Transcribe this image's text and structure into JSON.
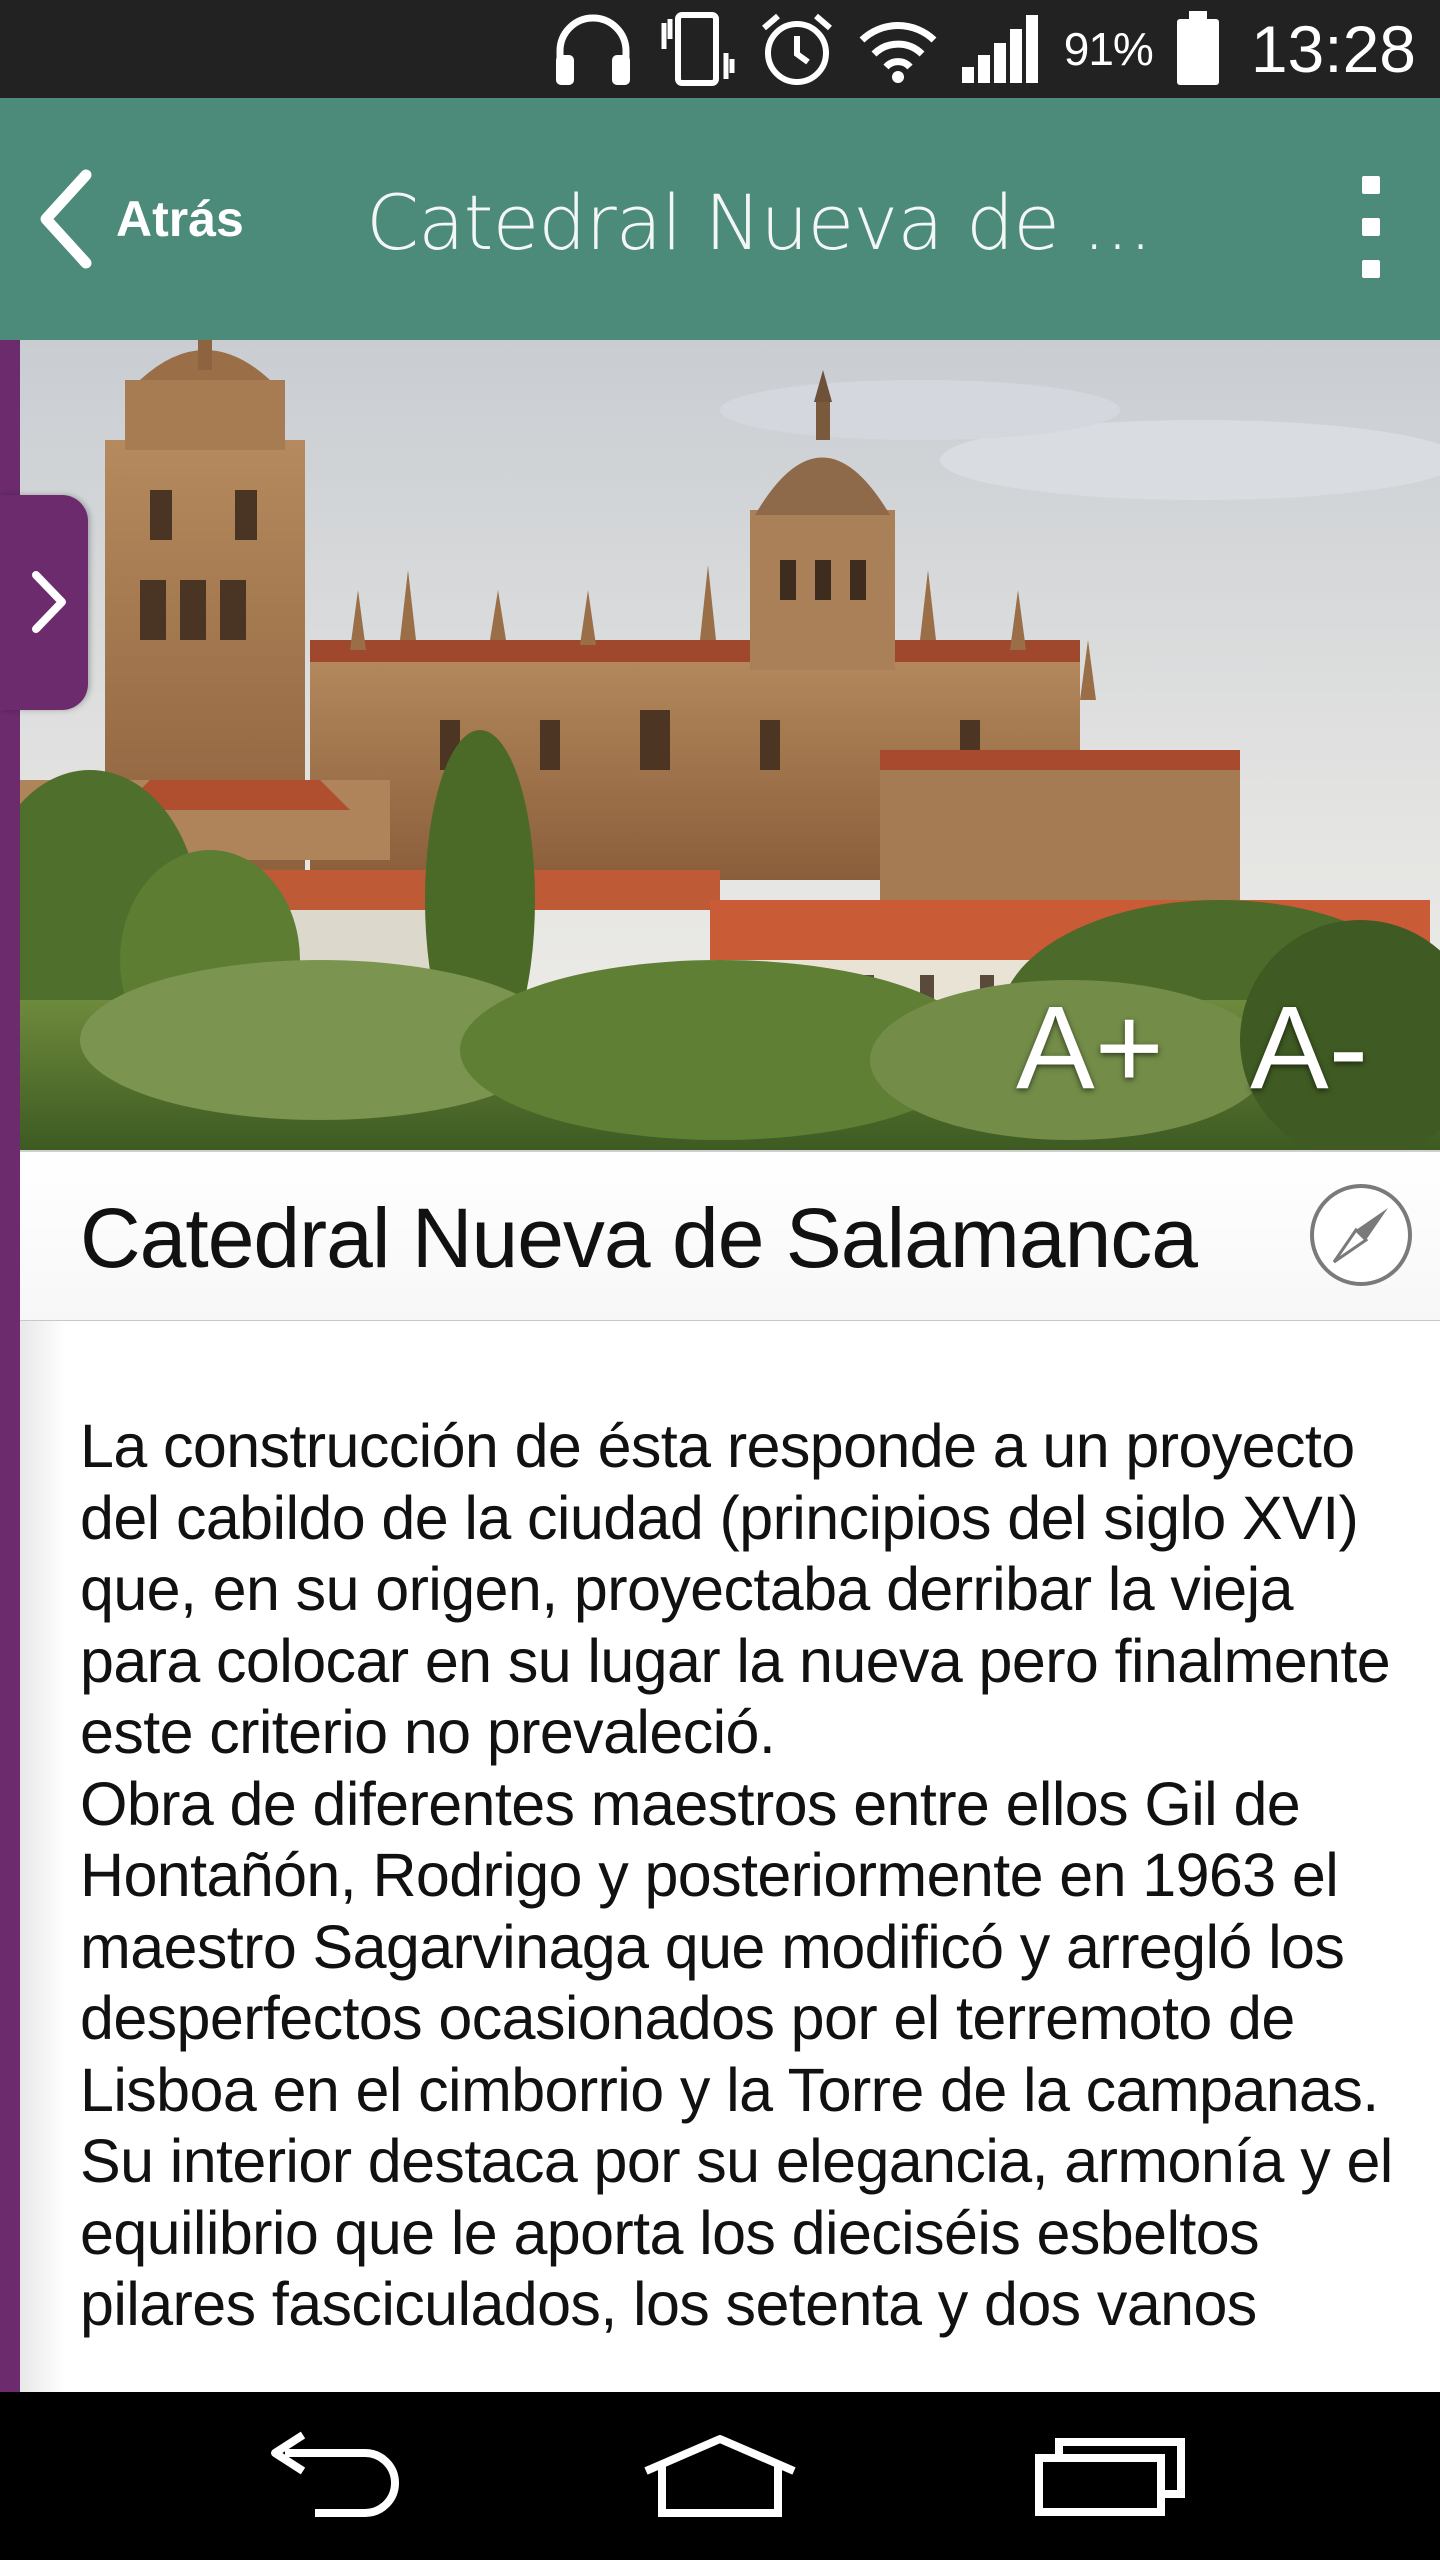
{
  "status_bar": {
    "battery_percent": "91%",
    "time": "13:28",
    "icons": [
      "headphones-icon",
      "vibrate-icon",
      "alarm-icon",
      "wifi-icon",
      "signal-icon",
      "battery-icon"
    ]
  },
  "app_bar": {
    "back_label": "Atrás",
    "title": "Catedral Nueva de ...",
    "overflow_icon": "more-vert-icon",
    "background": "#4c8a7a"
  },
  "drawer": {
    "color": "#6b2b6d",
    "handle_icon": "chevron-right-icon"
  },
  "hero": {
    "font_increase_label": "A+",
    "font_decrease_label": "A-"
  },
  "place": {
    "title": "Catedral Nueva de Salamanca",
    "compass_icon": "compass-icon",
    "description": "La construcción de ésta responde a un proyecto del cabildo de la ciudad (principios del siglo XVI) que, en su origen, proyectaba derribar la vieja para colocar en su lugar la nueva pero finalmente este criterio no prevaleció.\nObra de diferentes maestros entre ellos Gil de Hontañón, Rodrigo y posteriormente en 1963 el maestro Sagarvinaga que modificó y arregló los desperfectos ocasionados por el terremoto de Lisboa en el cimborrio y la Torre de la campanas.\nSu interior destaca por su elegancia, armonía y el equilibrio que le aporta los dieciséis esbeltos pilares fasciculados, los setenta y dos vanos"
  },
  "nav_bar": {
    "back_icon": "back-arrow-icon",
    "home_icon": "home-icon",
    "recents_icon": "recent-apps-icon"
  }
}
